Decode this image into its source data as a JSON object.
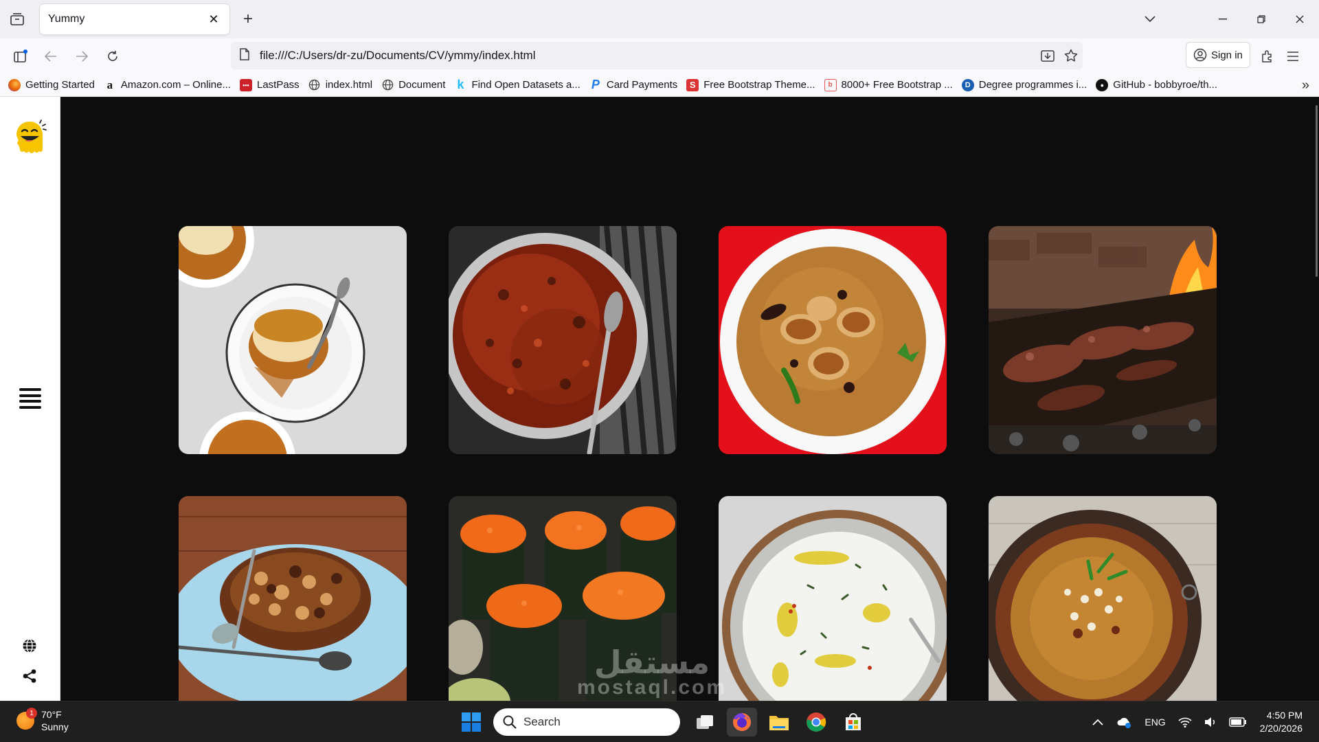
{
  "browser": {
    "tab_title": "Yummy",
    "url": "file:///C:/Users/dr-zu/Documents/CV/ymmy/index.html",
    "sign_in_label": "Sign in"
  },
  "bookmarks": [
    {
      "label": "Getting Started",
      "icon": "firefox-icon",
      "color": "#e66000"
    },
    {
      "label": "Amazon.com – Online...",
      "icon": "amazon-icon",
      "color": "#111111"
    },
    {
      "label": "LastPass",
      "icon": "lastpass-icon",
      "color": "#cc2029"
    },
    {
      "label": "index.html",
      "icon": "globe-icon",
      "color": "#444444"
    },
    {
      "label": "Document",
      "icon": "globe-icon",
      "color": "#444444"
    },
    {
      "label": "Find Open Datasets a...",
      "icon": "kaggle-icon",
      "color": "#20beff"
    },
    {
      "label": "Card Payments",
      "icon": "paypal-icon",
      "color": "#1f7bf2"
    },
    {
      "label": "Free Bootstrap Theme...",
      "icon": "startbootstrap-icon",
      "color": "#dd3333"
    },
    {
      "label": "8000+ Free Bootstrap ...",
      "icon": "bootstrap-icon",
      "color": "#e8554e"
    },
    {
      "label": "Degree programmes i...",
      "icon": "d-icon",
      "color": "#1a5fb4"
    },
    {
      "label": "GitHub - bobbyroe/th...",
      "icon": "github-icon",
      "color": "#111111"
    }
  ],
  "gallery": [
    {
      "name": "meal-card-flan",
      "colors": {
        "bg": "#dcdcdc",
        "accent": "#b86a1e",
        "dish": "#f3e2b8"
      }
    },
    {
      "name": "meal-card-stew",
      "colors": {
        "bg": "#3a3a3a",
        "accent": "#8e2a12",
        "dish": "#c8c8c8"
      }
    },
    {
      "name": "meal-card-kabsa",
      "colors": {
        "bg": "#e0121c",
        "accent": "#b8782f",
        "dish": "#ffffff"
      }
    },
    {
      "name": "meal-card-grill",
      "colors": {
        "bg": "#2b1c16",
        "accent": "#6b3a2a",
        "dish": "#ff9a1c"
      }
    },
    {
      "name": "meal-card-stew-bowl",
      "colors": {
        "bg": "#8a4a2c",
        "accent": "#5e2d18",
        "dish": "#a9d4e8"
      }
    },
    {
      "name": "meal-card-sushi",
      "colors": {
        "bg": "#2a2a24",
        "accent": "#f06a1a",
        "dish": "#1d2a1d"
      }
    },
    {
      "name": "meal-card-yogurt",
      "colors": {
        "bg": "#d8d8d8",
        "accent": "#f2f2ee",
        "dish": "#8a6a4a"
      }
    },
    {
      "name": "meal-card-soup",
      "colors": {
        "bg": "#c9c4bc",
        "accent": "#b57a2c",
        "dish": "#6a3a20"
      }
    }
  ],
  "watermark": {
    "arabic": "مستقل",
    "latin": "mostaql.com"
  },
  "taskbar": {
    "temperature": "70°F",
    "condition": "Sunny",
    "weather_badge": "1",
    "search_label": "Search",
    "language": "ENG",
    "time": "4:50 PM",
    "date": "2/20/2026"
  }
}
